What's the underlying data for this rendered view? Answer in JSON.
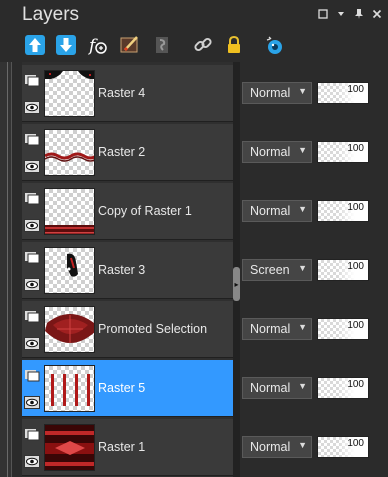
{
  "panel": {
    "title": "Layers",
    "window_buttons": [
      "restore-icon",
      "menu-icon",
      "pin-icon",
      "close-icon"
    ]
  },
  "toolbar": {
    "tools": [
      {
        "icon": "move-up-icon"
      },
      {
        "icon": "move-down-icon"
      },
      {
        "icon": "new-layer-icon"
      },
      {
        "icon": "edit-layer-icon"
      },
      {
        "icon": "mask-icon"
      },
      {
        "icon": "link-icon"
      },
      {
        "icon": "lock-icon"
      },
      {
        "icon": "visibility-toggle-icon"
      }
    ]
  },
  "layers": [
    {
      "name": "Raster 4",
      "blend": "Normal",
      "opacity": "100",
      "opacity_pct": 100,
      "selected": false
    },
    {
      "name": "Raster 2",
      "blend": "Normal",
      "opacity": "100",
      "opacity_pct": 100,
      "selected": false
    },
    {
      "name": "Copy of Raster 1",
      "blend": "Normal",
      "opacity": "100",
      "opacity_pct": 100,
      "selected": false
    },
    {
      "name": "Raster 3",
      "blend": "Screen",
      "opacity": "100",
      "opacity_pct": 100,
      "selected": false
    },
    {
      "name": "Promoted Selection",
      "blend": "Normal",
      "opacity": "100",
      "opacity_pct": 100,
      "selected": false
    },
    {
      "name": "Raster 5",
      "blend": "Normal",
      "opacity": "100",
      "opacity_pct": 100,
      "selected": true
    },
    {
      "name": "Raster 1",
      "blend": "Normal",
      "opacity": "100",
      "opacity_pct": 100,
      "selected": false
    }
  ],
  "colors": {
    "selected": "#3399ff",
    "accent_red": "#b01818",
    "icon_blue": "#2aa3e8"
  }
}
